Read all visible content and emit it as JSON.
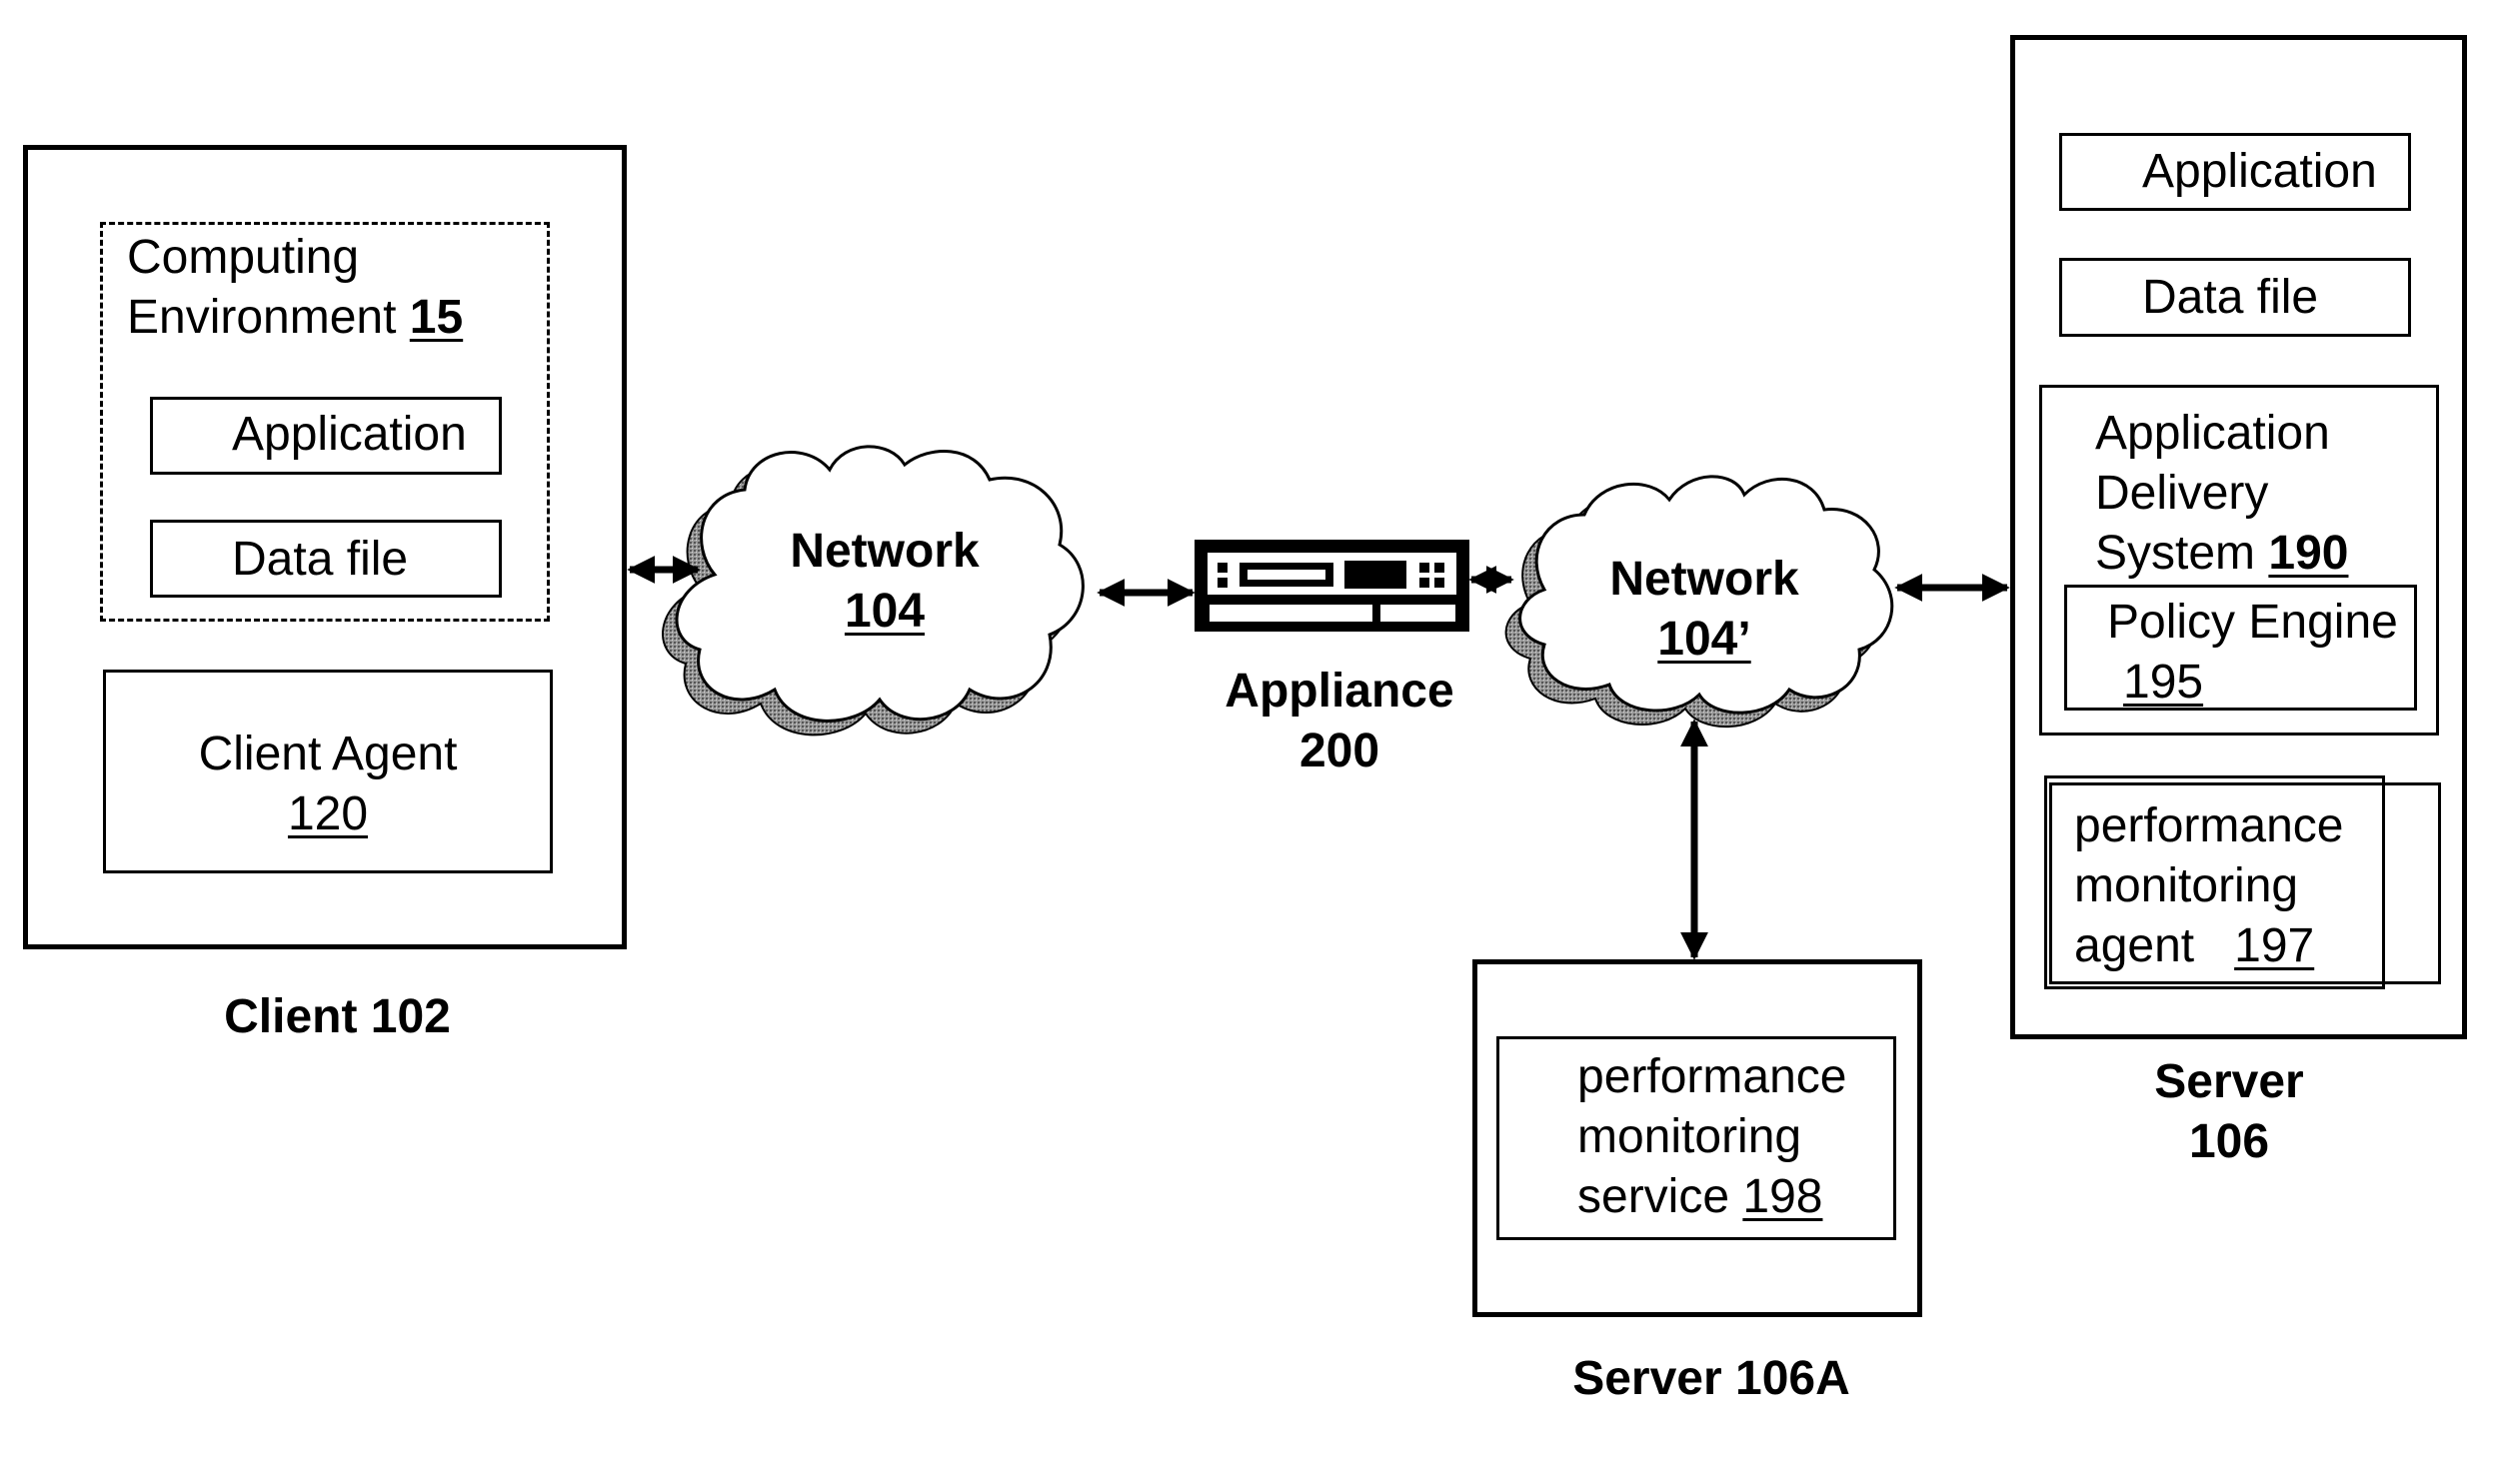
{
  "client": {
    "label": "Client 102",
    "computing_env": {
      "line1": "Computing",
      "line2": "Environment ",
      "ref": "15"
    },
    "application": "Application",
    "data_file": "Data file",
    "client_agent": {
      "line1": "Client Agent",
      "ref": "120"
    }
  },
  "network1": {
    "name": "Network",
    "ref": "104"
  },
  "appliance": {
    "line1": "Appliance",
    "line2": "200"
  },
  "network2": {
    "name": "Network",
    "ref": "104’"
  },
  "server": {
    "label_line1": "Server",
    "label_line2": "106",
    "application": "Application",
    "data_file": "Data file",
    "ads": {
      "line1": "Application",
      "line2": "Delivery",
      "line3": "System ",
      "ref": "190"
    },
    "policy_engine": {
      "line1": "Policy Engine",
      "ref": "195"
    },
    "pm_agent": {
      "line1": "performance",
      "line2": "monitoring",
      "line3": "agent   ",
      "ref": "197"
    }
  },
  "server_a": {
    "label": "Server 106A",
    "pm_service": {
      "line1": "performance",
      "line2": "monitoring",
      "line3": "service ",
      "ref": "198"
    }
  },
  "connections": [
    {
      "from": "client-102",
      "to": "network-104",
      "type": "bidirectional"
    },
    {
      "from": "network-104",
      "to": "appliance-200",
      "type": "bidirectional"
    },
    {
      "from": "appliance-200",
      "to": "network-104-prime",
      "type": "bidirectional"
    },
    {
      "from": "network-104-prime",
      "to": "server-106",
      "type": "bidirectional"
    },
    {
      "from": "network-104-prime",
      "to": "server-106a",
      "type": "bidirectional"
    }
  ]
}
